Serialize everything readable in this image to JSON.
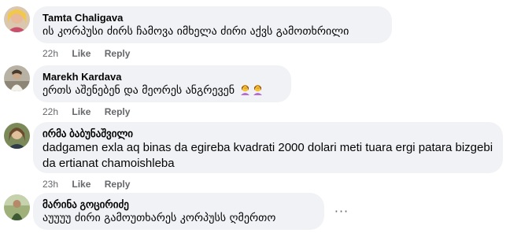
{
  "comments": [
    {
      "author": "Tamta Chaligava",
      "text": "ის კორპუსი ძირს ჩამოვა იმხელა ძირი აქვს გამოთხრილი",
      "time": "22h",
      "like": "Like",
      "reply": "Reply"
    },
    {
      "author": "Marekh Kardava",
      "text": "ერთს აშენებენ და მეორეს ანგრევენ",
      "emoji": "person-facepalming",
      "time": "22h",
      "like": "Like",
      "reply": "Reply"
    },
    {
      "author": "ირმა ბაბუნაშვილი",
      "text_line1": "dadgamen exla aq binas da egireba kvadrati 2000 dolari meti tuara ergi patara bizgebi",
      "text_line2": "da ertianat chamoishleba",
      "time": "23h",
      "like": "Like",
      "reply": "Reply"
    },
    {
      "author": "მარინა გოცირიძე",
      "text": "აუუუუ ძირი გამოუთხარეს კორპუსს ღმერთო",
      "more": "···"
    }
  ],
  "colors": {
    "bubble": "#f0f2f5",
    "text": "#050505",
    "meta": "#65676b"
  }
}
